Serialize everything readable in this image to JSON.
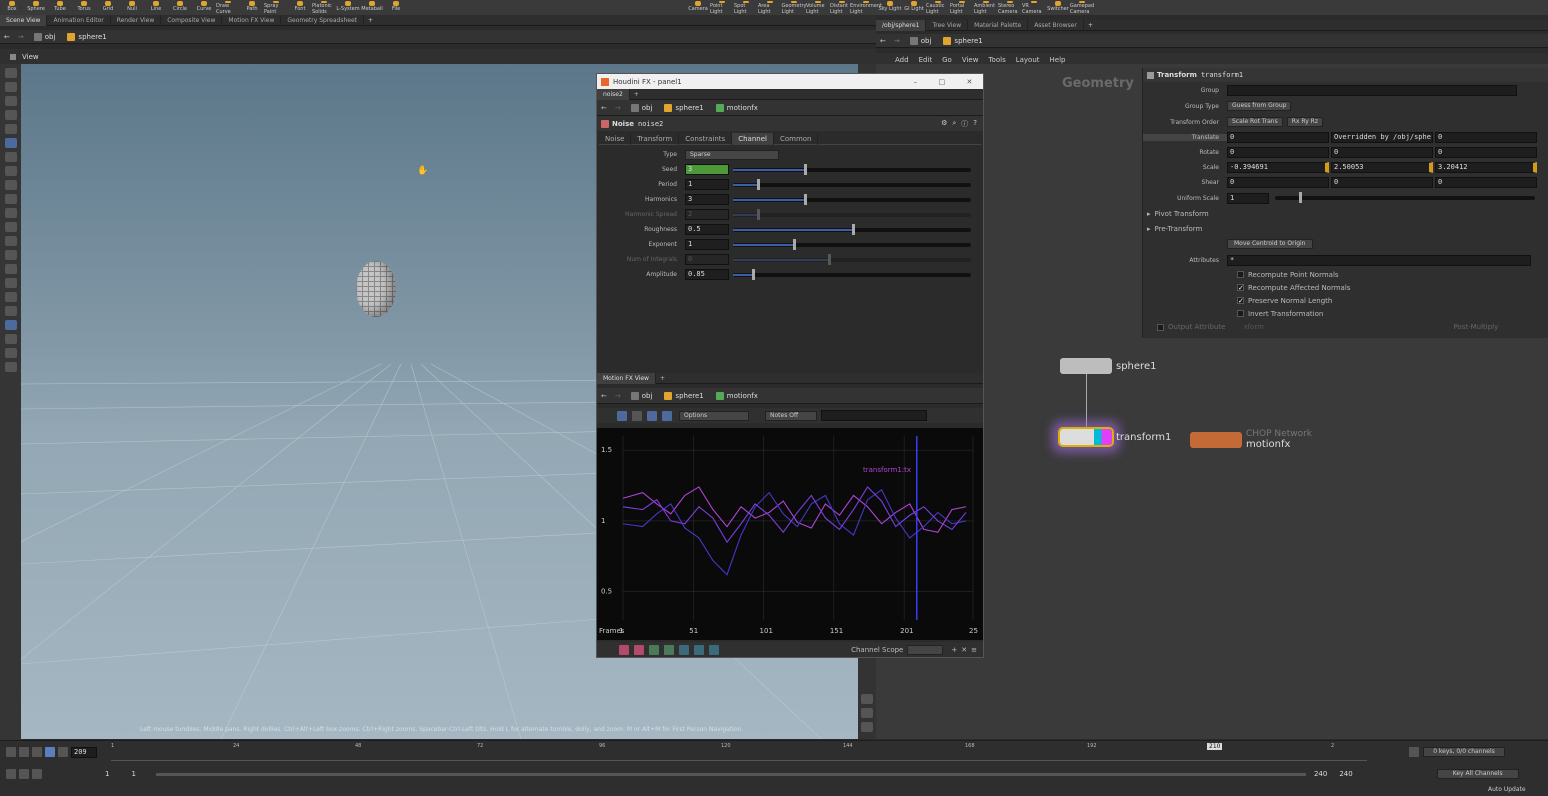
{
  "shelf": {
    "left_tools": [
      "Box",
      "Sphere",
      "Tube",
      "Torus",
      "Grid",
      "Null",
      "Line",
      "Circle",
      "Curve",
      "Draw Curve",
      "Path",
      "Spray Paint",
      "Font",
      "Platonic Solids",
      "L-System",
      "Metaball",
      "File"
    ],
    "right_tools": [
      "Camera",
      "Point Light",
      "Spot Light",
      "Area Light",
      "Geometry Light",
      "Volume Light",
      "Distant Light",
      "Environment Light",
      "Sky Light",
      "GI Light",
      "Caustic Light",
      "Portal Light",
      "Ambient Light",
      "Stereo Camera",
      "VR Camera",
      "Switcher",
      "Gamepad Camera"
    ]
  },
  "left_tabs": [
    "Scene View",
    "Animation Editor",
    "Render View",
    "Composite View",
    "Motion FX View",
    "Geometry Spreadsheet"
  ],
  "right_tabs": [
    "/obj/sphere1",
    "Tree View",
    "Material Palette",
    "Asset Browser"
  ],
  "left_path": {
    "obj": "obj",
    "node": "sphere1"
  },
  "right_path": {
    "obj": "obj",
    "node": "sphere1"
  },
  "viewport": {
    "label": "View",
    "info": "Left mouse tumbles. Middle pans. Right dollies. Ctrl+Alt+Left box-zooms. Ctrl+Right zooms. Spacebar-Ctrl-Left tilts. Hold L for alternate tumble, dolly, and zoom.    M or Alt+M for First Person Navigation."
  },
  "fx_window": {
    "title": "Houdini FX - panel1",
    "tab": "noise2",
    "path": {
      "obj": "obj",
      "node": "sphere1",
      "chop": "motionfx"
    },
    "node_type": "Noise",
    "node_name": "noise2",
    "param_tabs": [
      "Noise",
      "Transform",
      "Constraints",
      "Channel",
      "Common"
    ],
    "active_tab": "Channel",
    "params": [
      {
        "label": "Type",
        "value": "Sparse",
        "kind": "menu"
      },
      {
        "label": "Seed",
        "value": "3",
        "kind": "num",
        "fill": 0.3,
        "green": true
      },
      {
        "label": "Period",
        "value": "1",
        "kind": "num",
        "fill": 0.1
      },
      {
        "label": "Harmonics",
        "value": "3",
        "kind": "num",
        "fill": 0.3
      },
      {
        "label": "Harmonic Spread",
        "value": "2",
        "kind": "num",
        "fill": 0.1,
        "dim": true
      },
      {
        "label": "Roughness",
        "value": "0.5",
        "kind": "num",
        "fill": 0.5
      },
      {
        "label": "Exponent",
        "value": "1",
        "kind": "num",
        "fill": 0.25
      },
      {
        "label": "Num of Integrals",
        "value": "0",
        "kind": "num",
        "fill": 0.4,
        "dim": true
      },
      {
        "label": "Amplitude",
        "value": "0.85",
        "kind": "num",
        "fill": 0.08
      }
    ],
    "motion_view": {
      "tab": "Motion FX View",
      "options_label": "Options",
      "notes_label": "Notes Off",
      "channel_scope_label": "Channel Scope",
      "legend": "transform1:tx",
      "frames_label": "Frames"
    }
  },
  "chart_data": {
    "type": "line",
    "xlabel": "Frames",
    "x_ticks": [
      "1",
      "51",
      "101",
      "151",
      "201",
      "25"
    ],
    "y_ticks": [
      "1.5",
      "1",
      "0.5"
    ],
    "xlim": [
      1,
      250
    ],
    "ylim": [
      0.3,
      1.6
    ],
    "current_frame": 210,
    "series": [
      {
        "color": "#b044d4",
        "x": [
          1,
          15,
          25,
          35,
          45,
          55,
          65,
          75,
          85,
          95,
          105,
          115,
          125,
          135,
          145,
          155,
          165,
          175,
          185,
          195,
          205,
          215,
          225,
          235,
          245
        ],
        "values": [
          1.16,
          1.2,
          1.12,
          1.05,
          1.18,
          1.24,
          1.08,
          0.96,
          1.1,
          1.02,
          1.06,
          1.14,
          0.99,
          0.95,
          1.12,
          1.04,
          1.18,
          1.1,
          0.98,
          1.06,
          1.12,
          0.94,
          0.92,
          1.08,
          1.1
        ]
      },
      {
        "color": "#4338c8",
        "x": [
          1,
          15,
          25,
          35,
          45,
          55,
          65,
          75,
          85,
          95,
          105,
          115,
          125,
          135,
          145,
          155,
          165,
          175,
          185,
          195,
          205,
          215,
          225,
          235,
          245
        ],
        "values": [
          0.98,
          0.96,
          1.05,
          1.12,
          0.95,
          0.88,
          0.72,
          0.62,
          0.9,
          1.1,
          1.2,
          1.05,
          0.96,
          1.12,
          1.18,
          0.98,
          0.9,
          1.15,
          1.22,
          1.02,
          0.88,
          0.96,
          1.06,
          0.98,
          1.0
        ]
      },
      {
        "color": "#7a3ee0",
        "x": [
          1,
          15,
          25,
          35,
          45,
          55,
          65,
          75,
          85,
          95,
          105,
          115,
          125,
          135,
          145,
          155,
          165,
          175,
          185,
          195,
          205,
          215,
          225,
          235,
          245
        ],
        "values": [
          1.1,
          1.08,
          1.15,
          1.0,
          0.98,
          1.1,
          1.02,
          0.85,
          0.98,
          1.12,
          1.04,
          0.92,
          1.06,
          1.18,
          1.02,
          0.94,
          1.08,
          1.24,
          1.14,
          0.96,
          1.04,
          1.1,
          1.0,
          0.94,
          1.06
        ]
      }
    ]
  },
  "network": {
    "context": "Geometry",
    "nodes": [
      {
        "name": "sphere1"
      },
      {
        "name": "transform1"
      },
      {
        "name": "motionfx",
        "sub": "CHOP Network"
      }
    ]
  },
  "transform_params": {
    "type": "Transform",
    "name": "transform1",
    "group_label": "Group",
    "group_type_label": "Group Type",
    "group_type": "Guess from Group",
    "order_label": "Transform Order",
    "order": "Scale Rot Trans",
    "rot_order": "Rx Ry Rz",
    "translate_label": "Translate",
    "translate": [
      "0",
      "Overridden by /obj/sphe",
      "0"
    ],
    "rotate_label": "Rotate",
    "rotate": [
      "0",
      "0",
      "0"
    ],
    "scale_label": "Scale",
    "scale": [
      "-0.394691",
      "2.50053",
      "3.20412"
    ],
    "shear_label": "Shear",
    "shear": [
      "0",
      "0",
      "0"
    ],
    "uniform_label": "Uniform Scale",
    "uniform": "1",
    "pivot_label": "Pivot Transform",
    "pre_label": "Pre-Transform",
    "centroid_label": "Move Centroid to Origin",
    "attributes_label": "Attributes",
    "attributes": "*",
    "checks": [
      {
        "label": "Recompute Point Normals",
        "on": false
      },
      {
        "label": "Recompute Affected Normals",
        "on": true
      },
      {
        "label": "Preserve Normal Length",
        "on": true
      },
      {
        "label": "Invert Transformation",
        "on": false
      }
    ],
    "output_attr_label": "Output Attribute",
    "output_attr": "xform",
    "post_multiply": "Post-Multiply"
  },
  "right_menu": [
    "Add",
    "Edit",
    "Go",
    "View",
    "Tools",
    "Layout",
    "Help"
  ],
  "timeline": {
    "frame": "209",
    "start": "1",
    "start2": "1",
    "end": "240",
    "end2": "240",
    "marker": "210",
    "ticks": [
      "1",
      "24",
      "48",
      "72",
      "96",
      "120",
      "144",
      "168",
      "192",
      "216",
      "2"
    ],
    "keys_info": "0 keys, 0/0 channels",
    "key_all": "Key All Channels",
    "auto_update": "Auto Update"
  }
}
